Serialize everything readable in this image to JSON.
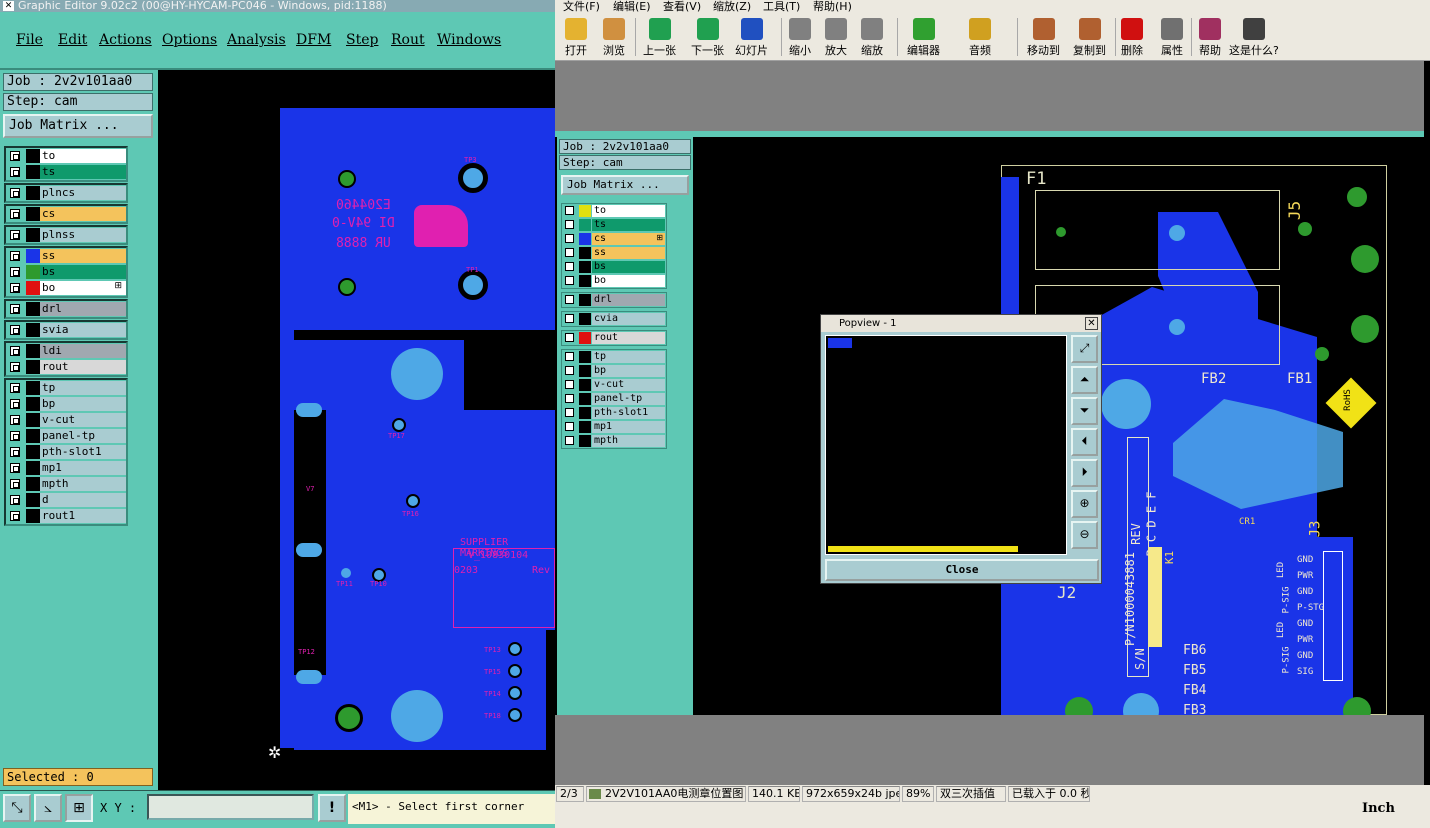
{
  "left_window": {
    "title": "Graphic Editor 9.02c2 (00@HY-HYCAM-PC046 - Windows, pid:1188)",
    "menu": [
      "File",
      "Edit",
      "Actions",
      "Options",
      "Analysis",
      "DFM",
      "Step",
      "Rout",
      "Windows"
    ],
    "job": "Job : 2v2v101aa0",
    "step": "Step: cam",
    "job_matrix": "Job Matrix ...",
    "layer_groups": [
      [
        {
          "name": "to",
          "color": "#ffffff",
          "sw": "#000000"
        },
        {
          "name": "ts",
          "color": "#0f9a6c",
          "sw": "#000000"
        }
      ],
      [
        {
          "name": "plncs",
          "color": "#a9ccd1",
          "sw": "#000000"
        }
      ],
      [
        {
          "name": "cs",
          "color": "#f4c35c",
          "sw": "#000000"
        }
      ],
      [
        {
          "name": "plnss",
          "color": "#a9ccd1",
          "sw": "#000000"
        }
      ],
      [
        {
          "name": "ss",
          "color": "#f4c35c",
          "sw": "#1a34e8"
        },
        {
          "name": "bs",
          "color": "#0f9a6c",
          "sw": "#2e9a2e"
        },
        {
          "name": "bo",
          "color": "#ffffff",
          "sw": "#e01010",
          "tag": "⊞"
        }
      ],
      [
        {
          "name": "drl",
          "color": "#a0a8b0",
          "sw": "#000000"
        }
      ],
      [
        {
          "name": "svia",
          "color": "#a9ccd1",
          "sw": "#000000"
        }
      ],
      [
        {
          "name": "ldi",
          "color": "#a0a8b0",
          "sw": "#000000"
        },
        {
          "name": "rout",
          "color": "#d8d8d8",
          "sw": "#000000"
        }
      ],
      [
        {
          "name": "tp",
          "color": "#a9ccd1",
          "sw": "#000000"
        },
        {
          "name": "bp",
          "color": "#a9ccd1",
          "sw": "#000000"
        },
        {
          "name": "v-cut",
          "color": "#a9ccd1",
          "sw": "#000000"
        },
        {
          "name": "panel-tp",
          "color": "#a9ccd1",
          "sw": "#000000"
        },
        {
          "name": "pth-slot1",
          "color": "#a9ccd1",
          "sw": "#000000"
        },
        {
          "name": "mp1",
          "color": "#a9ccd1",
          "sw": "#000000"
        },
        {
          "name": "mpth",
          "color": "#a9ccd1",
          "sw": "#000000"
        },
        {
          "name": "d",
          "color": "#a9ccd1",
          "sw": "#000000"
        },
        {
          "name": "rout1",
          "color": "#a9ccd1",
          "sw": "#000000"
        }
      ]
    ],
    "selected": "Selected : 0",
    "xy_label": "X Y :",
    "xy_value": "",
    "prompt": "<M1> - Select first corner",
    "toolbar_icons": [
      "zoom-box-icon",
      "measure-icon",
      "snap-grid-icon",
      "warning-icon"
    ],
    "pcb_labels": {
      "tp3": "TP3",
      "tp1": "TP1",
      "tp17": "TP17",
      "v7": "V7",
      "tp16": "TP16",
      "tp11": "TP11",
      "tp10": "TP10",
      "tp12": "TP12",
      "tp13": "TP13",
      "tp15": "TP15",
      "tp14": "TP14",
      "tp18": "TP18",
      "mark_a": "E204460",
      "mark_b": "DI 94V-0",
      "mark_c": "UR 8888",
      "supplier_title": "SUPPLIER MARKINGS",
      "supplier_num": "V_10830104",
      "supplier_rev": "Rev",
      "supplier_date": "0203"
    }
  },
  "right_window": {
    "menu": [
      "文件(F)",
      "编辑(E)",
      "查看(V)",
      "缩放(Z)",
      "工具(T)",
      "帮助(H)"
    ],
    "toolbar": [
      {
        "label": "打开",
        "icon": "open-folder-icon",
        "color": "#e4b230"
      },
      {
        "label": "浏览",
        "icon": "browse-icon",
        "color": "#d09040"
      },
      {
        "label": "上一张",
        "icon": "prev-image-icon",
        "color": "#20a050"
      },
      {
        "label": "下一张",
        "icon": "next-image-icon",
        "color": "#20a050"
      },
      {
        "label": "幻灯片",
        "icon": "slideshow-icon",
        "color": "#2050c0"
      },
      {
        "label": "缩小",
        "icon": "zoom-out-icon",
        "color": "#808080"
      },
      {
        "label": "放大",
        "icon": "zoom-in-icon",
        "color": "#808080"
      },
      {
        "label": "缩放",
        "icon": "zoom-icon",
        "color": "#808080"
      },
      {
        "label": "编辑器",
        "icon": "editor-icon",
        "color": "#30a030"
      },
      {
        "label": "音频",
        "icon": "audio-icon",
        "color": "#d0a020"
      },
      {
        "label": "移动到",
        "icon": "move-to-icon",
        "color": "#b06030"
      },
      {
        "label": "复制到",
        "icon": "copy-to-icon",
        "color": "#b06030"
      },
      {
        "label": "删除",
        "icon": "delete-icon",
        "color": "#d01010"
      },
      {
        "label": "属性",
        "icon": "properties-icon",
        "color": "#707070"
      },
      {
        "label": "帮助",
        "icon": "help-book-icon",
        "color": "#a03060"
      },
      {
        "label": "这是什么?",
        "icon": "whats-this-icon",
        "color": "#404040"
      }
    ],
    "inner_job": "Job : 2v2v101aa0",
    "inner_step": "Step: cam",
    "inner_job_matrix": "Job Matrix ...",
    "inner_groups": [
      [
        {
          "name": "to",
          "color": "#ffffff",
          "sw": "#e0e010"
        },
        {
          "name": "ts",
          "color": "#0f9a6c",
          "sw": "#0f9a6c"
        },
        {
          "name": "cs",
          "color": "#f4c35c",
          "sw": "#1a34e8",
          "tag": "⊞"
        },
        {
          "name": "ss",
          "color": "#f4c35c",
          "sw": "#000000"
        },
        {
          "name": "bs",
          "color": "#0f9a6c",
          "sw": "#000000"
        },
        {
          "name": "bo",
          "color": "#ffffff",
          "sw": "#000000"
        }
      ],
      [
        {
          "name": "drl",
          "color": "#a0a8b0",
          "sw": "#000000"
        }
      ],
      [
        {
          "name": "cvia",
          "color": "#a9ccd1",
          "sw": "#000000"
        }
      ],
      [
        {
          "name": "rout",
          "color": "#d8d8d8",
          "sw": "#e01010"
        }
      ],
      [
        {
          "name": "tp",
          "color": "#a9ccd1",
          "sw": "#000000"
        },
        {
          "name": "bp",
          "color": "#a9ccd1",
          "sw": "#000000"
        },
        {
          "name": "v-cut",
          "color": "#a9ccd1",
          "sw": "#000000"
        },
        {
          "name": "panel-tp",
          "color": "#a9ccd1",
          "sw": "#000000"
        },
        {
          "name": "pth-slot1",
          "color": "#a9ccd1",
          "sw": "#000000"
        },
        {
          "name": "mp1",
          "color": "#a9ccd1",
          "sw": "#000000"
        },
        {
          "name": "mpth",
          "color": "#a9ccd1",
          "sw": "#000000"
        }
      ]
    ],
    "popview": {
      "title": "Popview - 1",
      "close": "Close",
      "close_x": "✕"
    },
    "pcb_labels": {
      "f1": "F1",
      "j5": "J5",
      "fb2": "FB2",
      "fb1": "FB1",
      "rohs": "RoHS",
      "cr1": "CR1",
      "j3": "J3",
      "j2": "J2",
      "k1": "K1",
      "fb6": "FB6",
      "fb5": "FB5",
      "fb4": "FB4",
      "fb3": "FB3",
      "rev": "REV",
      "revcols": "B C D E F",
      "pn": "P/N1000043881",
      "sn": "S/N",
      "pins": [
        "GND",
        "PWR",
        "GND",
        "P-STG",
        "GND",
        "PWR",
        "GND",
        "SIG"
      ],
      "pinsA": [
        "LED",
        "P-SIG",
        "LED",
        "P-SIG"
      ]
    },
    "status": [
      "2/3",
      "2V2V101AA0电测章位置图",
      "140.1 KB",
      "972x659x24b jpeg",
      "89%",
      "双三次插值",
      "已载入于 0.0 秒"
    ],
    "unit": "Inch"
  }
}
